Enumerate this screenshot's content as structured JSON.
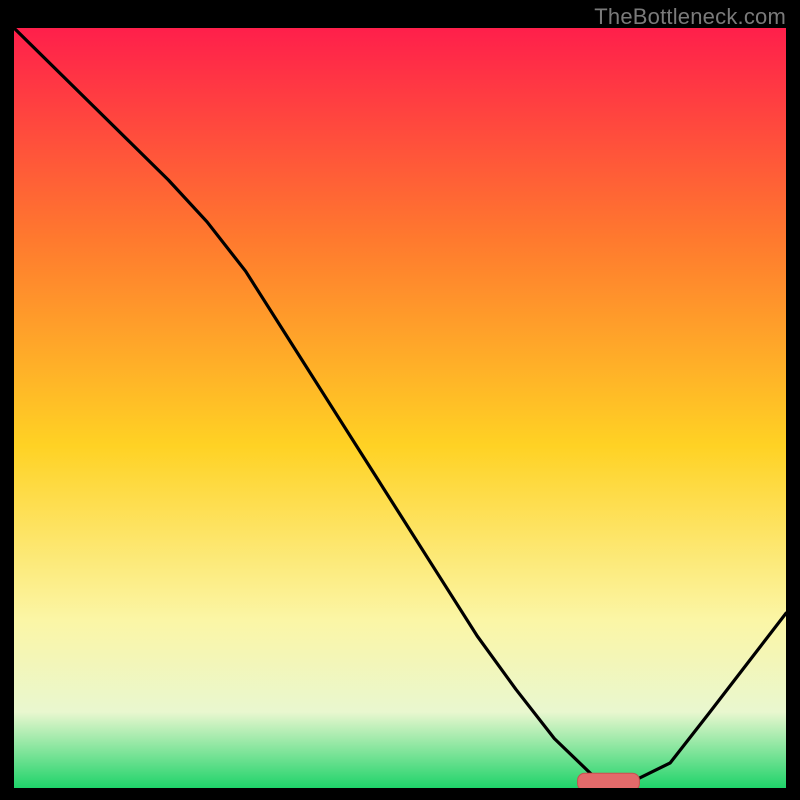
{
  "watermark": "TheBottleneck.com",
  "colors": {
    "gradient_top": "#ff1f4b",
    "gradient_mid_upper": "#ff7a2e",
    "gradient_mid": "#ffd224",
    "gradient_lower": "#fbf6a6",
    "gradient_pale": "#e9f7cf",
    "gradient_bottom": "#1fd36a",
    "curve": "#000000",
    "marker_fill": "#e26a6a",
    "marker_stroke": "#c94f4f",
    "frame": "#000000"
  },
  "chart_data": {
    "type": "line",
    "title": "",
    "xlabel": "",
    "ylabel": "",
    "xlim": [
      0,
      100
    ],
    "ylim": [
      0,
      100
    ],
    "grid": false,
    "legend": false,
    "series": [
      {
        "name": "bottleneck-curve",
        "x": [
          0,
          5,
          10,
          15,
          20,
          25,
          30,
          35,
          40,
          45,
          50,
          55,
          60,
          65,
          70,
          75,
          78,
          80,
          85,
          90,
          95,
          100
        ],
        "values": [
          100,
          95,
          90,
          85,
          80,
          74.5,
          68,
          60,
          52,
          44,
          36,
          28,
          20,
          13,
          6.5,
          1.6,
          0.8,
          0.8,
          3.3,
          9.8,
          16.4,
          23
        ]
      }
    ],
    "annotations": [
      {
        "name": "optimal-marker",
        "shape": "rounded-rect",
        "x_center": 77,
        "y_center": 0.8,
        "width": 8,
        "height": 2.3
      }
    ],
    "background_gradient_stops": [
      {
        "offset": 0.0,
        "color": "#ff1f4b"
      },
      {
        "offset": 0.28,
        "color": "#ff7a2e"
      },
      {
        "offset": 0.55,
        "color": "#ffd224"
      },
      {
        "offset": 0.78,
        "color": "#fbf6a6"
      },
      {
        "offset": 0.9,
        "color": "#e9f7cf"
      },
      {
        "offset": 1.0,
        "color": "#1fd36a"
      }
    ]
  }
}
